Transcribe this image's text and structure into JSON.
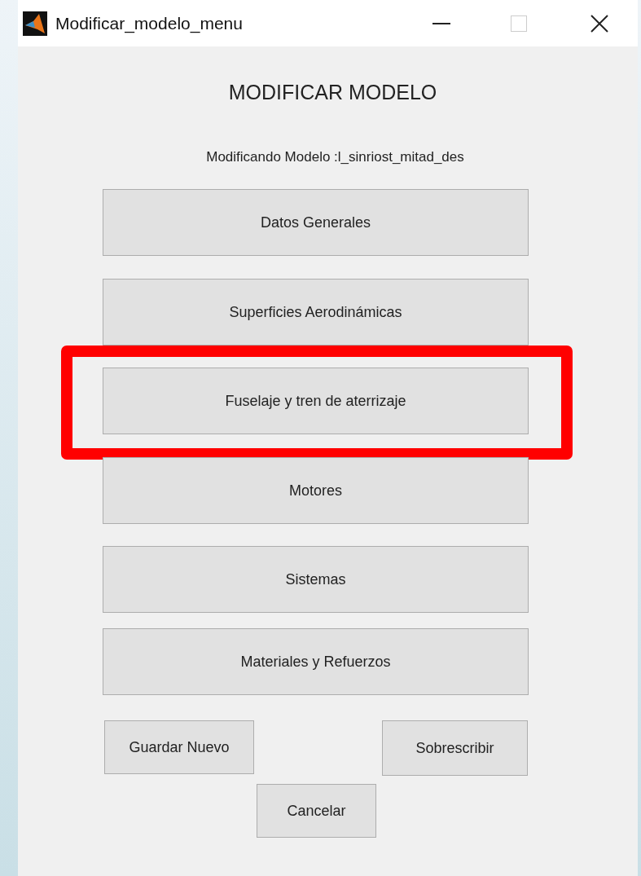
{
  "window": {
    "title": "Modificar_modelo_menu"
  },
  "heading": "MODIFICAR MODELO",
  "subtitle": "Modificando Modelo :l_sinriost_mitad_des",
  "menu_buttons": [
    {
      "label": "Datos Generales",
      "highlighted": false
    },
    {
      "label": "Superficies Aerodinámicas",
      "highlighted": false
    },
    {
      "label": "Fuselaje y tren de aterrizaje",
      "highlighted": true
    },
    {
      "label": "Motores",
      "highlighted": false
    },
    {
      "label": "Sistemas",
      "highlighted": false
    },
    {
      "label": "Materiales y Refuerzos",
      "highlighted": false
    }
  ],
  "actions": {
    "save_new": "Guardar Nuevo",
    "overwrite": "Sobrescribir",
    "cancel": "Cancelar"
  }
}
